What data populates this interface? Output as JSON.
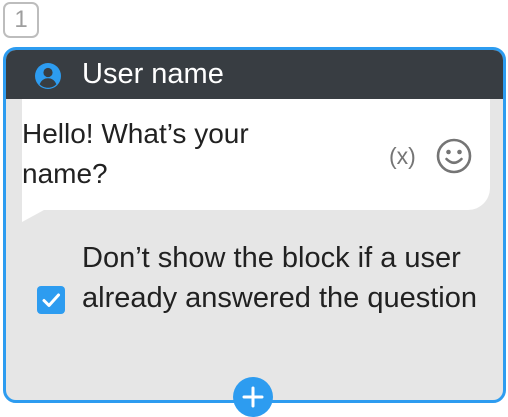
{
  "step": {
    "number": "1"
  },
  "card": {
    "title": "User name",
    "message": "Hello! What’s your name?",
    "variable_label": "(x)",
    "icons": {
      "header": "user-icon",
      "emoji": "smiley-icon",
      "add": "plus-icon",
      "checkbox": "checkmark-icon"
    },
    "option": {
      "label": "Don’t show the block if a user already answered the question",
      "checked": true
    }
  },
  "colors": {
    "accent": "#2d9cf0",
    "header_bg": "#383d42",
    "card_bg": "#e6e6e6",
    "text": "#212121",
    "muted": "#757575"
  }
}
